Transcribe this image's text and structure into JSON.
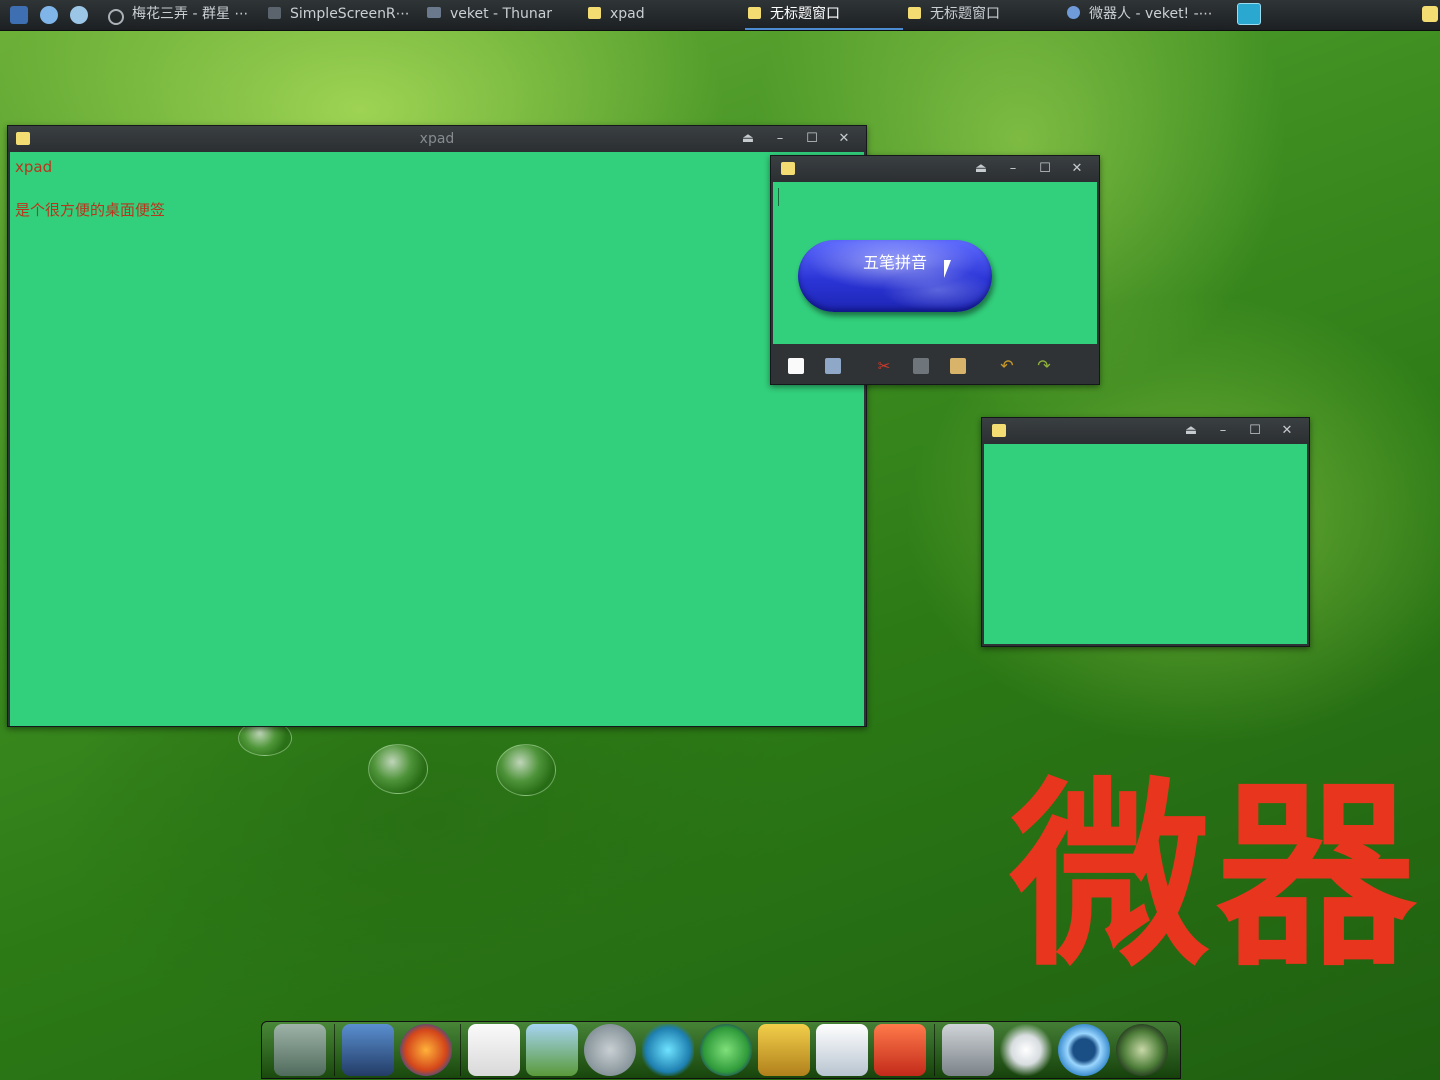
{
  "taskbar": {
    "tasks": [
      {
        "label": "梅花三弄 - 群星 ⋯"
      },
      {
        "label": "SimpleScreenR⋯"
      },
      {
        "label": "veket - Thunar"
      },
      {
        "label": "xpad"
      },
      {
        "label": "无标题窗口"
      },
      {
        "label": "无标题窗口"
      },
      {
        "label": "微器人 - veket! -⋯"
      }
    ]
  },
  "windows": {
    "main": {
      "title": "xpad",
      "line1": "xpad",
      "line2": "是个很方便的桌面便签"
    },
    "button_window": {
      "button_label": "五笔拼音"
    }
  },
  "desktop": {
    "wallpaper_text": "微器"
  },
  "colors": {
    "note_bg": "#32d07c",
    "note_text": "#b8361d",
    "wallpaper_text": "#e8351d",
    "pill_button": "#2b35d6"
  },
  "icons": {
    "window_controls": [
      "eject-icon",
      "minimize-icon",
      "maximize-icon",
      "close-icon"
    ],
    "note_toolbar": [
      "new-note-icon",
      "print-icon",
      "cut-icon",
      "copy-icon",
      "paste-icon",
      "undo-icon",
      "redo-icon"
    ]
  }
}
